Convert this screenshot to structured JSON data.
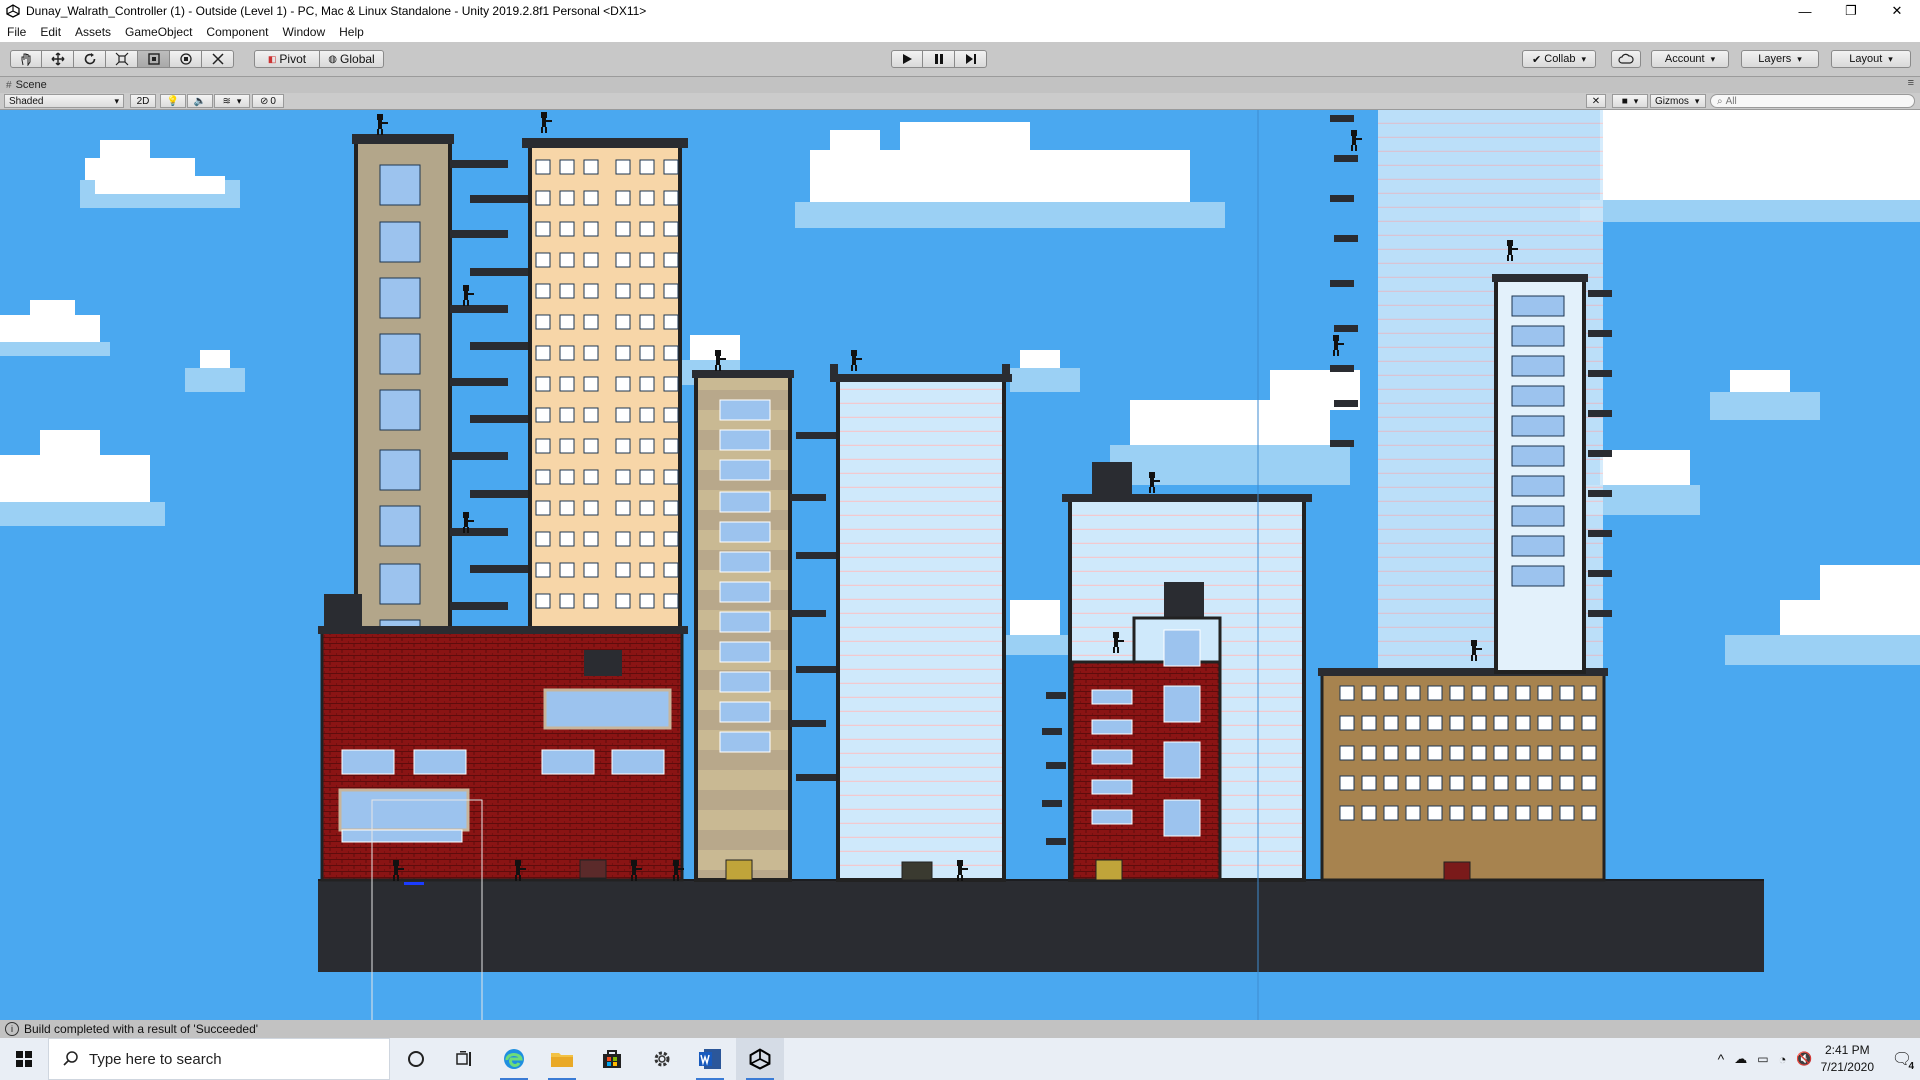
{
  "window": {
    "title": "Dunay_Walrath_Controller (1) - Outside (Level 1) - PC, Mac & Linux Standalone - Unity 2019.2.8f1 Personal <DX11>",
    "minimize": "—",
    "maximize": "❐",
    "close": "✕"
  },
  "menu": [
    "File",
    "Edit",
    "Assets",
    "GameObject",
    "Component",
    "Window",
    "Help"
  ],
  "toolbar": {
    "pivot": "Pivot",
    "global": "Global",
    "collab": "Collab",
    "account": "Account",
    "layers": "Layers",
    "layout": "Layout"
  },
  "scene_tab": {
    "label": "Scene",
    "menu_glyph": "≡"
  },
  "scene_toolbar": {
    "draw_mode": "Shaded",
    "mode_2d": "2D",
    "hidden_count": "0",
    "gizmos": "Gizmos",
    "search_placeholder": "All"
  },
  "status": {
    "message": "Build completed with a result of 'Succeeded'"
  },
  "taskbar": {
    "search_placeholder": "Type here to search",
    "time": "2:41 PM",
    "date": "7/21/2020",
    "notifications": "4"
  },
  "colors": {
    "sky": "#4aa8f0",
    "ground": "#2a2c31",
    "brick": "#8a1414",
    "accent": "#3a7bd5"
  }
}
